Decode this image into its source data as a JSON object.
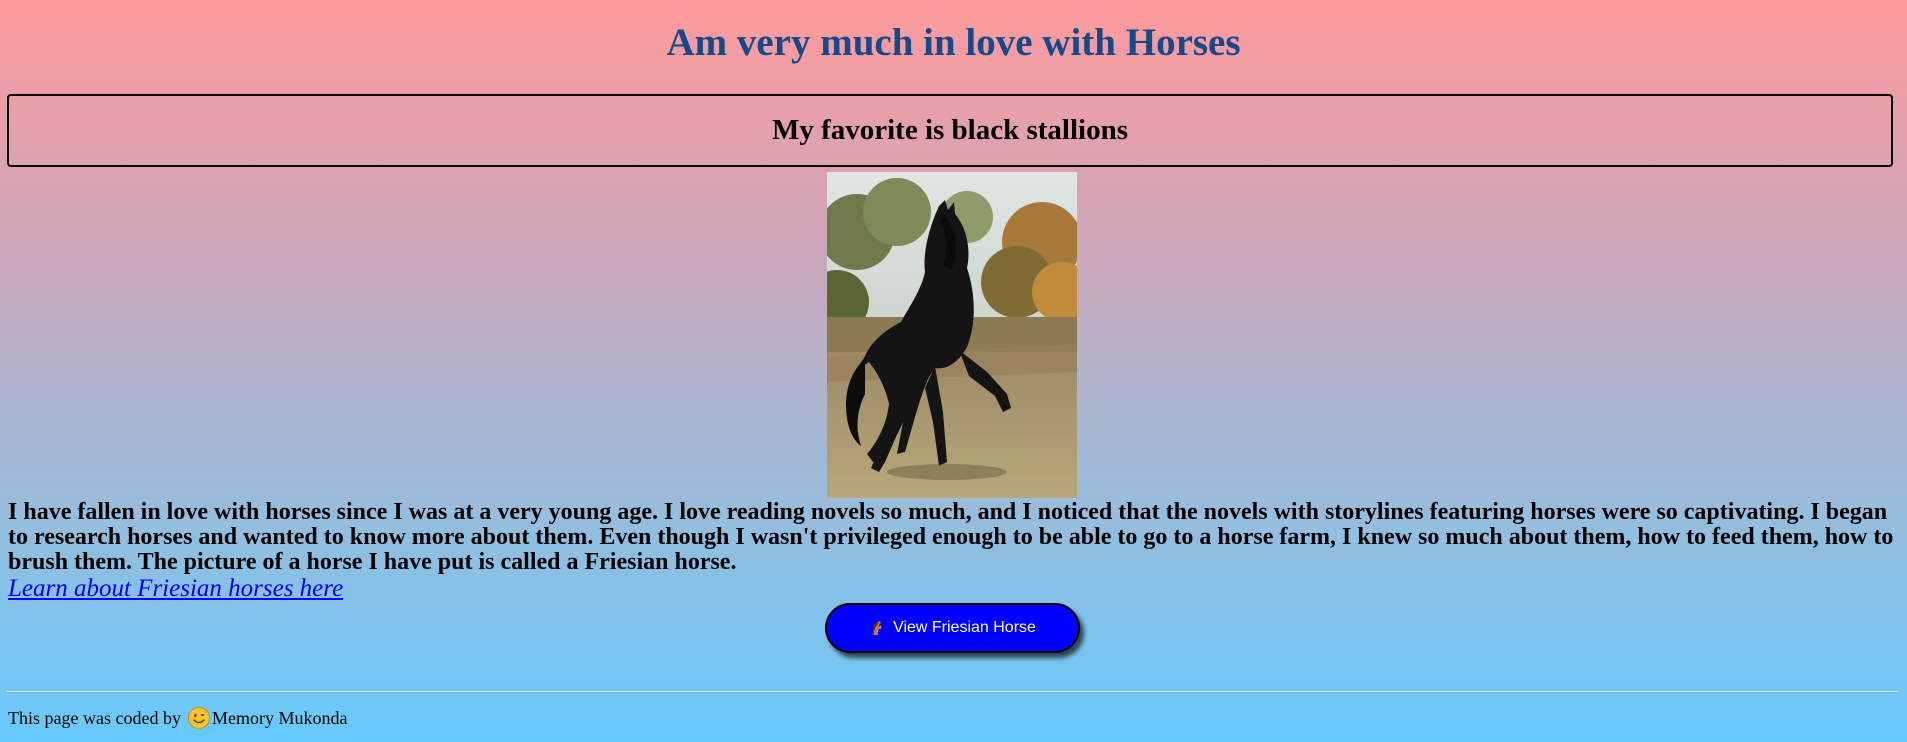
{
  "header": {
    "title": "Am very much in love with Horses",
    "subtitle": "My favorite is black stallions"
  },
  "main": {
    "image_icon": "black-friesian-horse-photo",
    "paragraph": "I have fallen in love with horses since I was at a very young age. I love reading novels so much, and I noticed that the novels with storylines featuring horses were so captivating. I began to research horses and wanted to know more about them. Even though I wasn't privileged enough to be able to go to a horse farm, I knew so much about them, how to feed them, how to brush them. The picture of a horse I have put is called a Friesian horse.",
    "link_text": "Learn about Friesian horses here",
    "button_label": "View Friesian Horse",
    "button_icon": "horse-head-icon"
  },
  "footer": {
    "prefix": "This page was coded by",
    "icon": "smiley-icon",
    "author": "Memory Mukonda"
  },
  "colors": {
    "title": "#16498a",
    "button_bg": "#0000ff",
    "link": "#0000ee",
    "gradient_top": "#fe9a9b",
    "gradient_bottom": "#66c9fc"
  }
}
